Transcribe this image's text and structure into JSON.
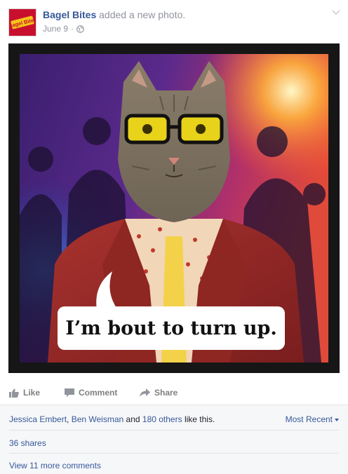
{
  "post": {
    "page_name": "Bagel Bites",
    "action_text": " added a new photo.",
    "date": "June 9",
    "separator": "·",
    "audience_icon": "globe-icon",
    "options_icon": "chevron-down-icon",
    "brand_color": "#c8102e",
    "avatar_logo_text": "Bagel Bites"
  },
  "photo": {
    "caption": "I’m bout to turn up."
  },
  "actions": {
    "like": "Like",
    "comment": "Comment",
    "share": "Share"
  },
  "social": {
    "liker_1": "Jessica Embert",
    "comma": ", ",
    "liker_2": "Ben Weisman",
    "and_text": " and ",
    "others": "180 others",
    "suffix": " like this.",
    "sort_label": "Most Recent",
    "shares": "36 shares",
    "view_more": "View 11 more comments"
  }
}
